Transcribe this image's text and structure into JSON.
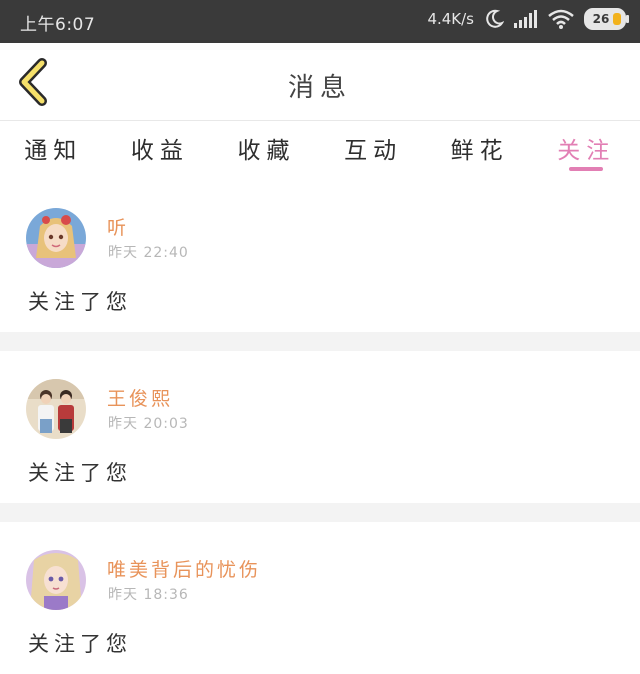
{
  "status_bar": {
    "time": "上午6:07",
    "network_speed": "4.4K/s",
    "battery": "26",
    "icons": [
      "moon-icon",
      "signal-icon",
      "wifi-icon",
      "battery-icon"
    ]
  },
  "header": {
    "title": "消息",
    "back_icon": "chevron-left-icon"
  },
  "tabs": [
    {
      "label": "通知"
    },
    {
      "label": "收益"
    },
    {
      "label": "收藏"
    },
    {
      "label": "互动"
    },
    {
      "label": "鲜花"
    },
    {
      "label": "关注"
    }
  ],
  "active_tab": "关注",
  "colors": {
    "accent": "#e27fb4",
    "name": "#e8935a",
    "back_icon": "#f5e06a"
  },
  "messages": [
    {
      "name": "听",
      "time": "昨天 22:40",
      "text": "关注了您",
      "avatar": "avatar-icon"
    },
    {
      "name": "王俊熙",
      "time": "昨天 20:03",
      "text": "关注了您",
      "avatar": "avatar-icon"
    },
    {
      "name": "唯美背后的忧伤",
      "time": "昨天 18:36",
      "text": "关注了您",
      "avatar": "avatar-icon"
    }
  ]
}
